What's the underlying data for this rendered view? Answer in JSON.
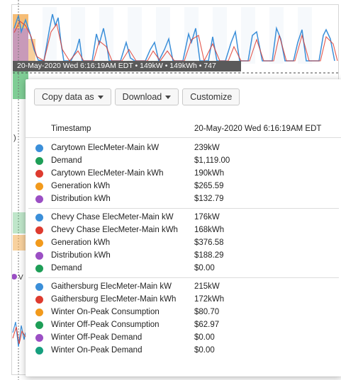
{
  "hover_readout": "20-May-2020 Wed 6:16:19AM EDT • 149kW • 149kWh • 747",
  "toolbar": {
    "copy_label": "Copy data as",
    "download_label": "Download",
    "customize_label": "Customize"
  },
  "header": {
    "label": "Timestamp",
    "value": "20-May-2020 Wed 6:16:19AM EDT"
  },
  "colors": {
    "blue": "#3b8fd9",
    "green": "#1e9e57",
    "red": "#de3b2f",
    "orange": "#f29a1c",
    "purple": "#9b4fc4",
    "teal": "#169f7e"
  },
  "groups": [
    {
      "rows": [
        {
          "color": "blue",
          "label": "Carytown ElecMeter-Main kW",
          "value": "239kW"
        },
        {
          "color": "green",
          "label": "Demand",
          "value": "$1,119.00"
        },
        {
          "color": "red",
          "label": "Carytown ElecMeter-Main kWh",
          "value": "190kWh"
        },
        {
          "color": "orange",
          "label": "Generation kWh",
          "value": "$265.59"
        },
        {
          "color": "purple",
          "label": "Distribution kWh",
          "value": "$132.79"
        }
      ]
    },
    {
      "rows": [
        {
          "color": "blue",
          "label": "Chevy Chase ElecMeter-Main kW",
          "value": "176kW"
        },
        {
          "color": "red",
          "label": "Chevy Chase ElecMeter-Main kWh",
          "value": "168kWh"
        },
        {
          "color": "orange",
          "label": "Generation kWh",
          "value": "$376.58"
        },
        {
          "color": "purple",
          "label": "Distribution kWh",
          "value": "$188.29"
        },
        {
          "color": "green",
          "label": "Demand",
          "value": "$0.00"
        }
      ]
    },
    {
      "rows": [
        {
          "color": "blue",
          "label": "Gaithersburg ElecMeter-Main kW",
          "value": "215kW"
        },
        {
          "color": "red",
          "label": "Gaithersburg ElecMeter-Main kWh",
          "value": "172kWh"
        },
        {
          "color": "orange",
          "label": "Winter On-Peak Consumption",
          "value": "$80.70"
        },
        {
          "color": "green",
          "label": "Winter Off-Peak Consumption",
          "value": "$62.97"
        },
        {
          "color": "purple",
          "label": "Winter Off-Peak Demand",
          "value": "$0.00"
        },
        {
          "color": "teal",
          "label": "Winter On-Peak Demand",
          "value": "$0.00"
        }
      ]
    }
  ]
}
